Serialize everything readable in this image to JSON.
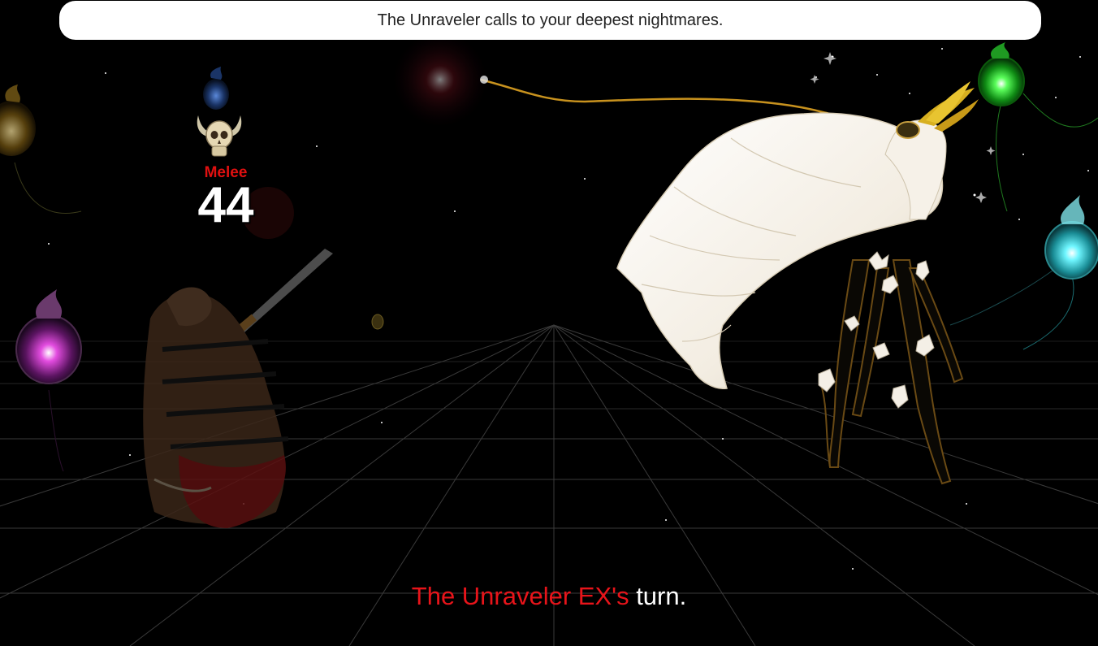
{
  "top_message": "The Unraveler calls to your deepest nightmares.",
  "damage_popup": {
    "type": "Melee",
    "value": "44"
  },
  "turn_indicator": {
    "actor": "The Unraveler EX's",
    "suffix": " turn."
  },
  "colors": {
    "background": "#000000",
    "banner_bg": "#ffffff",
    "damage_type": "#e01010",
    "turn_actor": "#e8141a",
    "orb_green": "#2bd12b",
    "orb_cyan": "#2fd6dc",
    "orb_magenta": "#c42bb8",
    "orb_blue": "#2a5fa8",
    "wing": "#f4efe6",
    "tether": "#c8921e"
  },
  "icons": [
    "skull-horned-icon",
    "potion-orb-icon"
  ]
}
